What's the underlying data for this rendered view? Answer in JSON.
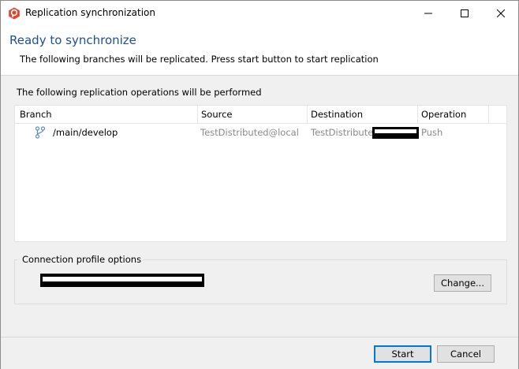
{
  "window": {
    "title": "Replication synchronization"
  },
  "header": {
    "title": "Ready to synchronize",
    "subtitle": "The following branches will be replicated. Press start button to start replication"
  },
  "operations": {
    "label": "The following replication operations will be performed",
    "columns": [
      "Branch",
      "Source",
      "Destination",
      "Operation"
    ],
    "rows": [
      {
        "branch": "/main/develop",
        "source": "TestDistributed@local",
        "destination": "TestDistributed",
        "operation": "Push"
      }
    ]
  },
  "connection": {
    "legend": "Connection profile options",
    "change_label": "Change..."
  },
  "footer": {
    "start_label": "Start",
    "cancel_label": "Cancel"
  },
  "icons": {
    "app": "plastic-scm-icon",
    "branch": "branch-icon",
    "minimize": "minimize-icon",
    "maximize": "maximize-icon",
    "close": "close-icon"
  },
  "colors": {
    "header_title": "#1e4f8f",
    "muted_text": "#8a8a8a",
    "app_icon": "#e0462c",
    "branch_icon": "#5b8cc9",
    "default_button_border": "#0078d7"
  }
}
